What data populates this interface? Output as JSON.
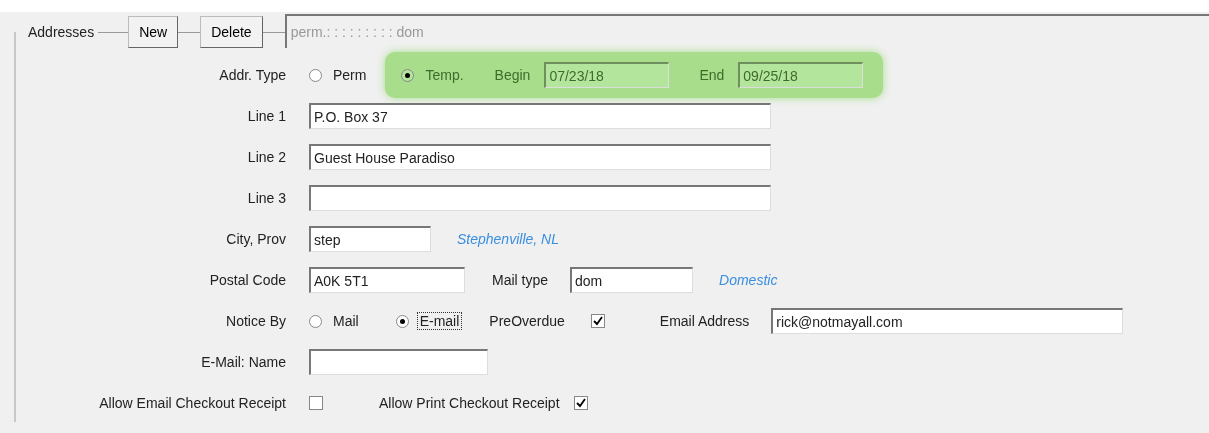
{
  "group": {
    "title": "Addresses"
  },
  "toolbar": {
    "buttons": [
      "New",
      "Delete"
    ],
    "summary_field": {
      "value": "perm.: : : : : : : : : dom",
      "disabled": true
    }
  },
  "addr_type": {
    "label": "Addr. Type",
    "highlighted": true,
    "options": [
      {
        "label": "Perm",
        "selected": false
      },
      {
        "label": "Temp.",
        "selected": true
      }
    ],
    "begin_label": "Begin",
    "begin": "07/23/18",
    "end_label": "End",
    "end": "09/25/18"
  },
  "lines": [
    {
      "label": "Line 1",
      "value": "P.O. Box 37"
    },
    {
      "label": "Line 2",
      "value": "Guest House Paradiso"
    },
    {
      "label": "Line 3"
    }
  ],
  "city": {
    "label": "City, Prov",
    "value": "step",
    "lookup": "Stephenville, NL"
  },
  "postal": {
    "label": "Postal Code",
    "value": "A0K 5T1",
    "mail_type_label": "Mail type",
    "mail_type": "dom",
    "lookup": "Domestic"
  },
  "notice": {
    "label": "Notice By",
    "options": [
      {
        "label": "Mail",
        "selected": false,
        "focused": false
      },
      {
        "label": "E-mail",
        "selected": true,
        "focused": true
      }
    ],
    "preoverdue": {
      "label": "PreOverdue",
      "checked": true
    },
    "email_label": "Email Address",
    "email": "rick@notmayall.com"
  },
  "email_name": {
    "label": "E-Mail: Name"
  },
  "receipts": [
    {
      "label": "Allow Email Checkout Receipt",
      "checked": false
    },
    {
      "label": "Allow Print Checkout Receipt",
      "checked": true
    }
  ]
}
